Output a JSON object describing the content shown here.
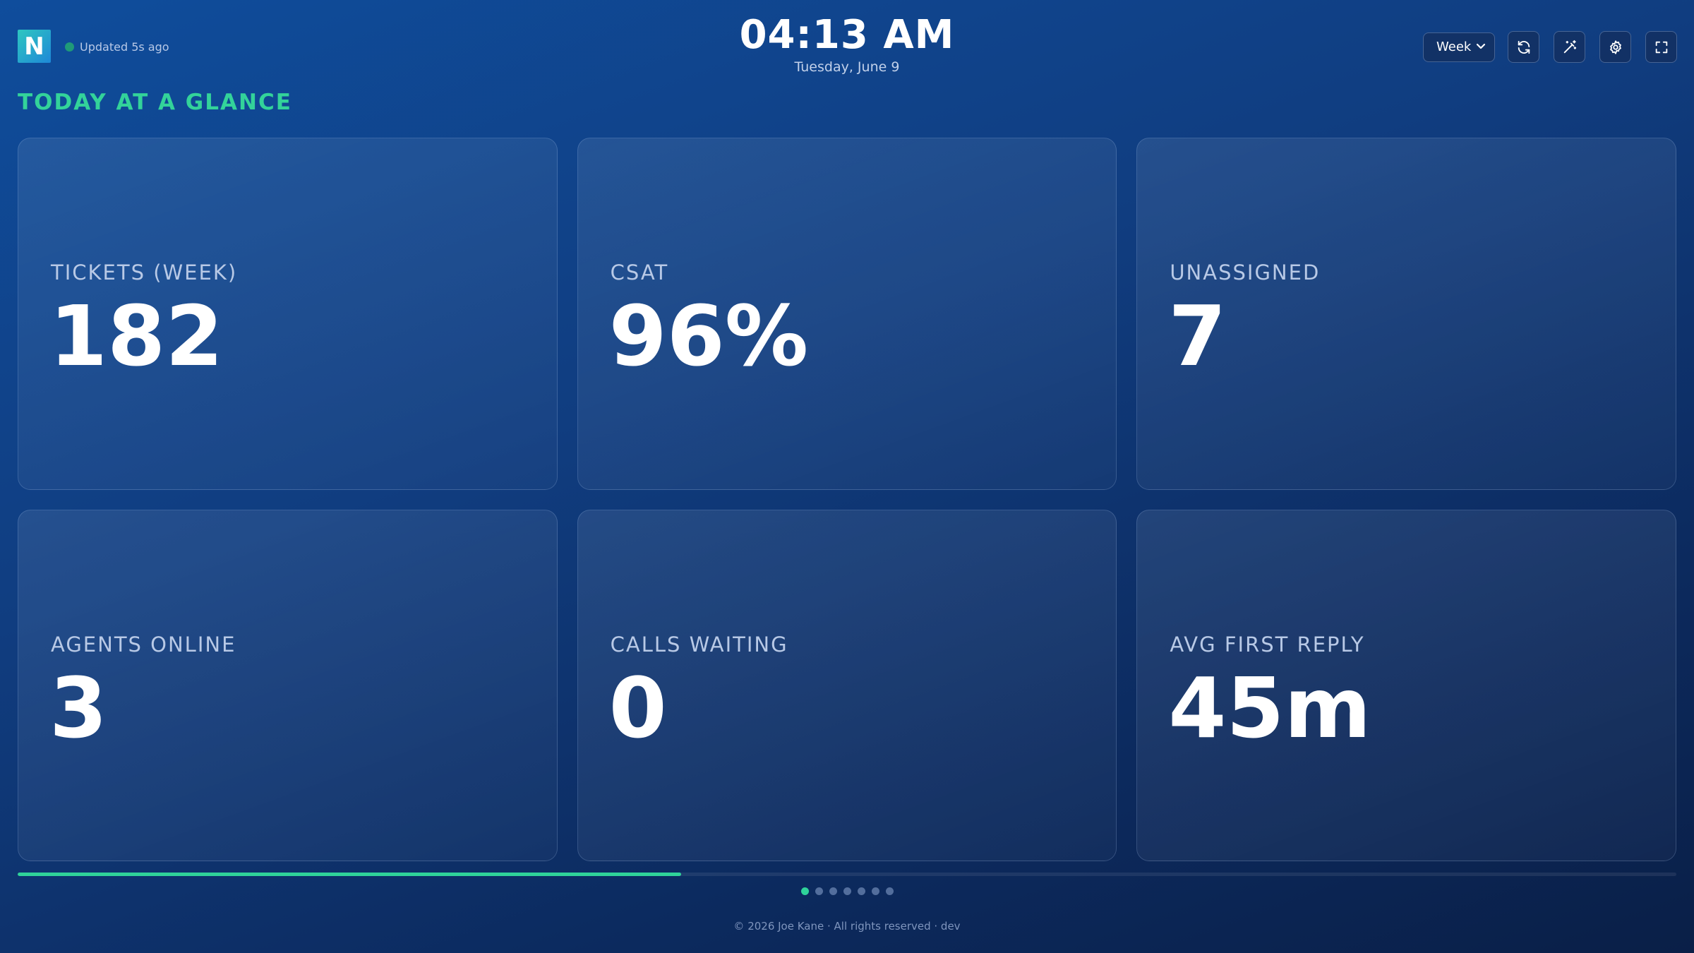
{
  "header": {
    "logo_letter": "N",
    "status": "Updated 5s ago",
    "time": "04:13 AM",
    "date": "Tuesday, June 9",
    "period_select": "Week"
  },
  "icons": [
    "refresh-icon",
    "magic-wand-icon",
    "gear-icon",
    "fullscreen-icon"
  ],
  "section_title": "TODAY AT A GLANCE",
  "cards": [
    {
      "label": "TICKETS (WEEK)",
      "value": "182"
    },
    {
      "label": "CSAT",
      "value": "96%"
    },
    {
      "label": "UNASSIGNED",
      "value": "7"
    },
    {
      "label": "AGENTS ONLINE",
      "value": "3"
    },
    {
      "label": "CALLS WAITING",
      "value": "0"
    },
    {
      "label": "AVG FIRST REPLY",
      "value": "45m"
    }
  ],
  "rotation": {
    "progress": 0.4,
    "pages": 7,
    "active_page": 0
  },
  "footer": "© 2026 Joe Kane · All rights reserved · dev",
  "colors": {
    "accent": "#2fd39a",
    "status_dot": "#1f9a78"
  }
}
